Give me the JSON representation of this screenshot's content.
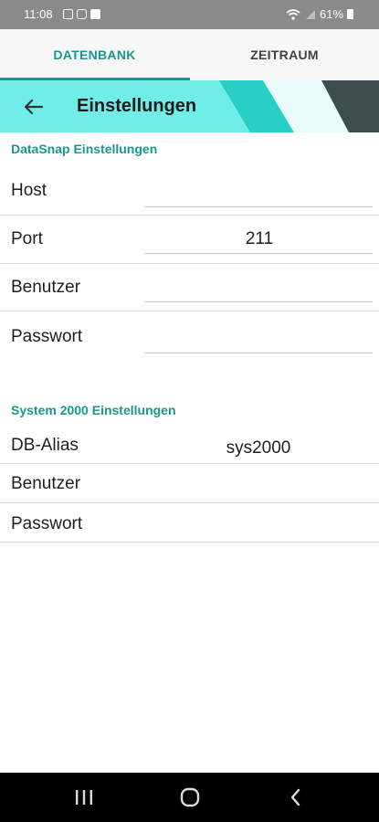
{
  "status_bar": {
    "time": "11:08",
    "battery": "61%",
    "icons": [
      "gallery-icon",
      "instagram-icon",
      "check-icon",
      "wifi-icon",
      "signal-icon",
      "battery-icon"
    ]
  },
  "tabs": [
    {
      "label": "DATENBANK",
      "active": true
    },
    {
      "label": "ZEITRAUM",
      "active": false
    }
  ],
  "toolbar": {
    "title": "Einstellungen"
  },
  "datasnap": {
    "title": "DataSnap Einstellungen",
    "host": {
      "label": "Host",
      "value": ""
    },
    "port": {
      "label": "Port",
      "value": "211"
    },
    "user": {
      "label": "Benutzer",
      "value": ""
    },
    "password": {
      "label": "Passwort",
      "value": ""
    }
  },
  "system2000": {
    "title": "System 2000 Einstellungen",
    "alias": {
      "label": "DB-Alias",
      "value": "sys2000"
    },
    "user": {
      "label": "Benutzer",
      "value": ""
    },
    "password": {
      "label": "Passwort",
      "value": ""
    }
  },
  "colors": {
    "accent": "#17988f",
    "toolbar": "#71ede7",
    "toolbar_dark": "#3d4d4d"
  }
}
